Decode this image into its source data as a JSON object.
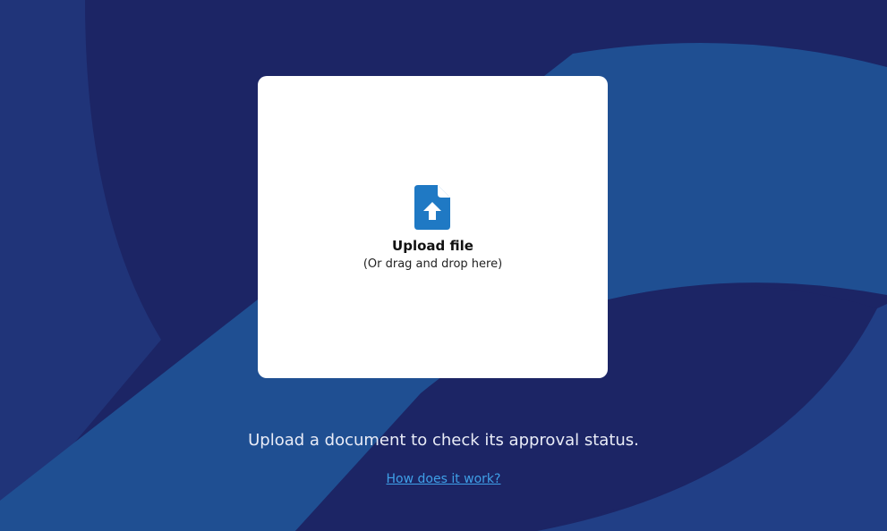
{
  "upload": {
    "title": "Upload file",
    "subtitle": "(Or drag and drop here)",
    "icon": "file-upload-icon"
  },
  "caption": "Upload a document to check its approval status.",
  "help_link": "How does it work?",
  "colors": {
    "background": "#1c2565",
    "accent_blue": "#1f79c4",
    "link": "#3fa0e8"
  }
}
